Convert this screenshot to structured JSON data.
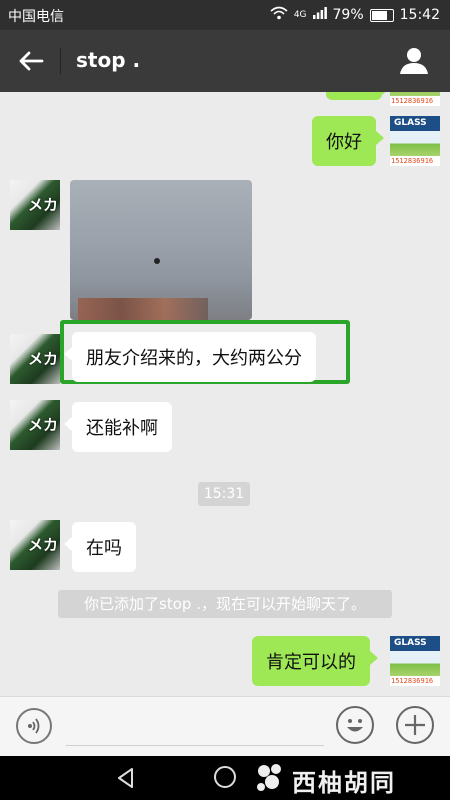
{
  "status_bar": {
    "carrier": "中国电信",
    "network": "4G",
    "battery": "79%",
    "battery_level": 0.79,
    "time": "15:42"
  },
  "header": {
    "title": "stop ."
  },
  "contact_avatar": {
    "mark": "メカ"
  },
  "self_avatar": {
    "brand": "GLASS",
    "phone": "1512836916"
  },
  "messages": [
    {
      "side": "right",
      "text": "你好"
    },
    {
      "side": "left",
      "type": "image"
    },
    {
      "side": "left",
      "text": "朋友介绍来的，大约两公分"
    },
    {
      "side": "left",
      "text": "还能补啊"
    },
    {
      "side": "left",
      "text": "在吗"
    },
    {
      "side": "right",
      "text": "肯定可以的"
    }
  ],
  "time_label": "15:31",
  "system_message": "你已添加了stop .，现在可以开始聊天了。",
  "watermark": {
    "text": "西柚胡同"
  },
  "colors": {
    "title_bar": "#3a3a3a",
    "chat_background": "#ebebeb",
    "outgoing_bubble": "#9ee856",
    "incoming_bubble": "#ffffff",
    "highlight": "#2aa52a"
  }
}
